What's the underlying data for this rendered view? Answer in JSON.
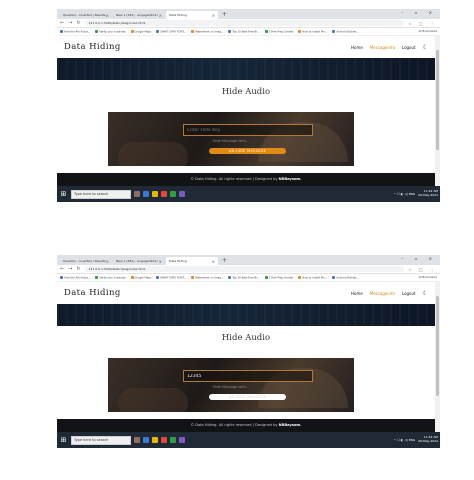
{
  "browser": {
    "tabs": [
      {
        "label": "Question - Inserted / Results"
      },
      {
        "label": "New 1 (281) - engaged101c"
      },
      {
        "label": "Data Hiding"
      }
    ],
    "new_tab": "+",
    "window_controls": "– ▫ ✕",
    "url": "127.0.0.1:5000/static/steg/index.html",
    "bookmarks": [
      {
        "label": "How the Pot Actua..."
      },
      {
        "label": "Verify your business"
      },
      {
        "label": "Google Maps"
      },
      {
        "label": "ONHIT DATA FONT..."
      },
      {
        "label": "Watermark on Imag..."
      },
      {
        "label": "Top 10 Best Free Br..."
      },
      {
        "label": "5 Free Prep Grades"
      },
      {
        "label": "How to Install Pro..."
      },
      {
        "label": "Android Builder..."
      }
    ],
    "bookmarks_right": "All Bookmarks"
  },
  "site": {
    "brand": "Data Hiding",
    "menu": [
      "Home",
      "Messageinfo",
      "Logout"
    ],
    "menu_icon": "moon-icon",
    "title": "Hide Audio",
    "footer_text": "© Data Hiding. All rights reserved | Designed by ",
    "footer_author": "NRBaysom."
  },
  "screens": [
    {
      "key_value": "",
      "key_placeholder": "Enter Hide Key",
      "message_text": "Hide Message with...",
      "button_label": "UN-HIDE MESSAGE"
    },
    {
      "key_value": "12345",
      "key_placeholder": "Enter Hide Key",
      "message_text": "Hide Message with...",
      "button_label": "UN-HIDE MESSAGE"
    }
  ],
  "taskbar": {
    "search_placeholder": "Type here to search",
    "time": "11:42 AM",
    "date": "06-May-2024",
    "tray_text": "^ ☐ ◐ ◁) ENG"
  },
  "colors": {
    "accent": "#e28a12",
    "active_menu": "#d9861a",
    "footer": "#111317",
    "taskbar": "#1f2a36",
    "up_button": "#1e90d6"
  }
}
